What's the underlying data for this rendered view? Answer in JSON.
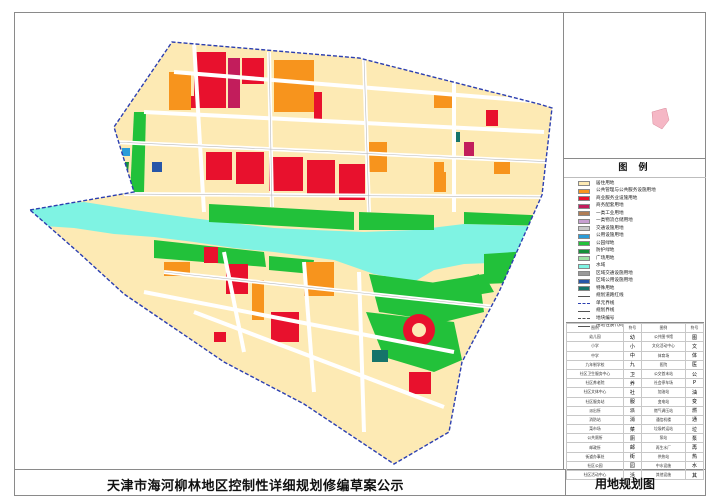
{
  "title": "天津市海河柳林地区控制性详细规划修编草案公示",
  "map_title": "用地规划图",
  "legend": {
    "heading": "图 例",
    "items": [
      {
        "label": "居住用地",
        "color": "#fdeab4",
        "kind": "fill"
      },
      {
        "label": "公共管理与公共服务设施用地",
        "color": "#f7941d",
        "kind": "fill"
      },
      {
        "label": "商业服务业设施用地",
        "color": "#e8112d",
        "kind": "fill"
      },
      {
        "label": "商务配套用地",
        "color": "#c21d5c",
        "kind": "fill"
      },
      {
        "label": "一类工业用地",
        "color": "#b07d55",
        "kind": "fill"
      },
      {
        "label": "一类物流仓储用地",
        "color": "#c79fd0",
        "kind": "fill"
      },
      {
        "label": "交通设施用地",
        "color": "#c8c8c8",
        "kind": "fill"
      },
      {
        "label": "公用设施用地",
        "color": "#2a9cd8",
        "kind": "fill"
      },
      {
        "label": "公园绿地",
        "color": "#22c13a",
        "kind": "fill"
      },
      {
        "label": "防护绿地",
        "color": "#15913a",
        "kind": "fill"
      },
      {
        "label": "广场用地",
        "color": "#9fe3a6",
        "kind": "fill"
      },
      {
        "label": "水域",
        "color": "#7ff3e3",
        "kind": "fill"
      },
      {
        "label": "区域交通设施用地",
        "color": "#9a9a9a",
        "kind": "fill"
      },
      {
        "label": "区域公用设施用地",
        "color": "#2756a8",
        "kind": "fill"
      },
      {
        "label": "特殊用地",
        "color": "#16746a",
        "kind": "fill"
      },
      {
        "label": "规划道路红线",
        "color": "#555555",
        "kind": "line"
      },
      {
        "label": "单元界线",
        "color": "#2c3fb0",
        "kind": "dash"
      },
      {
        "label": "规划界线",
        "color": "#555555",
        "kind": "line"
      },
      {
        "label": "地块编号",
        "color": "#555555",
        "kind": "dash"
      },
      {
        "label": "用地性质代码",
        "color": "#555555",
        "kind": "line"
      }
    ]
  },
  "symbols": {
    "rows": [
      [
        "图例",
        "符号",
        "图例",
        "符号"
      ],
      [
        "幼儿园",
        "幼",
        "公共图书馆",
        "图"
      ],
      [
        "小学",
        "小",
        "文化活动中心",
        "文"
      ],
      [
        "中学",
        "中",
        "体育场",
        "体"
      ],
      [
        "九年制学校",
        "九",
        "医院",
        "医"
      ],
      [
        "社区卫生服务中心",
        "卫",
        "公交首末站",
        "公"
      ],
      [
        "社区养老院",
        "养",
        "社会停车场",
        "P"
      ],
      [
        "社区文体中心",
        "社",
        "加油站",
        "油"
      ],
      [
        "社区服务站",
        "服",
        "变电站",
        "变"
      ],
      [
        "派出所",
        "派",
        "燃气调压站",
        "燃"
      ],
      [
        "消防站",
        "消",
        "通信机楼",
        "通"
      ],
      [
        "菜市场",
        "菜",
        "垃圾转运站",
        "垃"
      ],
      [
        "公共厕所",
        "厕",
        "泵站",
        "泵"
      ],
      [
        "邮政所",
        "邮",
        "再生水厂",
        "再"
      ],
      [
        "街道办事处",
        "街",
        "供热站",
        "热"
      ],
      [
        "社区公园",
        "园",
        "中水设施",
        "水"
      ],
      [
        "社区活动中心",
        "活",
        "其他设施",
        "其"
      ]
    ]
  }
}
